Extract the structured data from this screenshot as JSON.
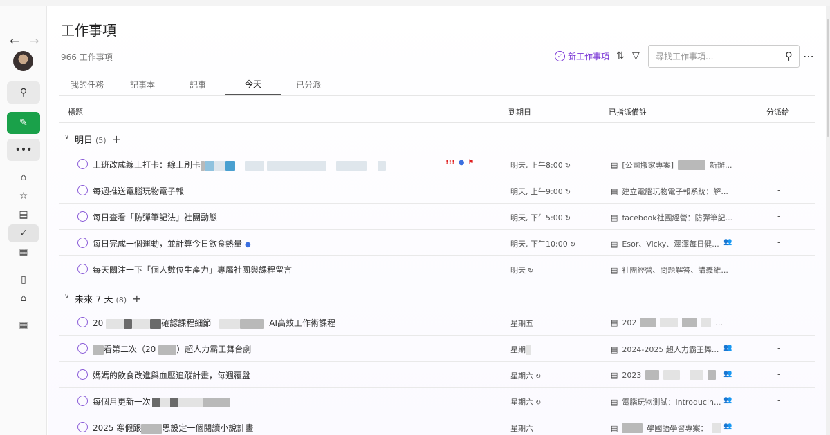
{
  "sidebar": {
    "back_icon": "back-arrow-icon",
    "forward_icon": "forward-arrow-icon",
    "items": [
      {
        "name": "search-icon"
      },
      {
        "name": "new-note-icon"
      },
      {
        "name": "more-icon"
      },
      {
        "name": "home-icon"
      },
      {
        "name": "star-icon"
      },
      {
        "name": "notes-icon"
      },
      {
        "name": "tasks-icon",
        "active": true
      },
      {
        "name": "calendar-icon"
      },
      {
        "name": "notebook-icon"
      },
      {
        "name": "tag-icon"
      },
      {
        "name": "apps-icon"
      }
    ],
    "accent_color": "#1aa14a"
  },
  "header": {
    "title": "工作事項",
    "count": "966 工作事項",
    "new_task_label": "新工作事項",
    "search_placeholder": "尋找工作事項...",
    "accent_color": "#7a36d6"
  },
  "tabs": [
    {
      "label": "我的任務"
    },
    {
      "label": "記事本"
    },
    {
      "label": "記事"
    },
    {
      "label": "今天",
      "active": true
    },
    {
      "label": "已分派"
    }
  ],
  "columns": {
    "title": "標題",
    "due": "到期日",
    "note": "已指派備註",
    "assign": "分派給"
  },
  "groups": [
    {
      "name": "明日",
      "count": "(5)",
      "rows": [
        {
          "title": "上班改成線上打卡：線上刷卡",
          "due": "明天, 上午8:00",
          "note": "[公司搬家專案]",
          "note_tail": "新辦...",
          "assign": "-"
        },
        {
          "title": "每週推送電腦玩物電子報",
          "due": "明天, 上午9:00",
          "note": "建立電腦玩物電子報系統：解...",
          "assign": "-"
        },
        {
          "title": "每日查看「防彈筆記法」社團動態",
          "due": "明天, 下午5:00",
          "note": "facebook社團經營：防彈筆記...",
          "assign": "-"
        },
        {
          "title": "每日完成一個運動，並計算今日飲食熱量",
          "due": "明天, 下午10:00",
          "note": "Esor、Vicky、澤澤每日健...",
          "assign": "-"
        },
        {
          "title": "每天關注一下「個人數位生產力」專屬社團與課程留言",
          "due": "明天",
          "note": "社團經營、問題解答、講義維...",
          "assign": "-"
        }
      ]
    },
    {
      "name": "未來 7 天",
      "count": "(8)",
      "rows": [
        {
          "title_a": "20",
          "title_b": "確認課程細節",
          "title_c": "AI高效工作術課程",
          "due": "星期五",
          "note": "202",
          "note_tail": "...",
          "assign": "-"
        },
        {
          "title_b": "看第二次（20",
          "title_c": "）超人力霸王舞台劇",
          "due": "星期",
          "note": "2024-2025 超人力霸王舞...",
          "assign": "-"
        },
        {
          "title": "媽媽的飲食改進與血壓追蹤計畫，每週覆盤",
          "due": "星期六",
          "note": "2023",
          "assign": "-"
        },
        {
          "title": "每個月更新一次",
          "due": "星期六",
          "note": "電腦玩物測試：Introducin...",
          "assign": "-"
        },
        {
          "title_a": "2025 寒假跟",
          "title_b": "思設定一個閱讀小說計畫",
          "due": "星期六",
          "note_tail": "學國語學習專案：",
          "assign": "-"
        }
      ]
    }
  ]
}
